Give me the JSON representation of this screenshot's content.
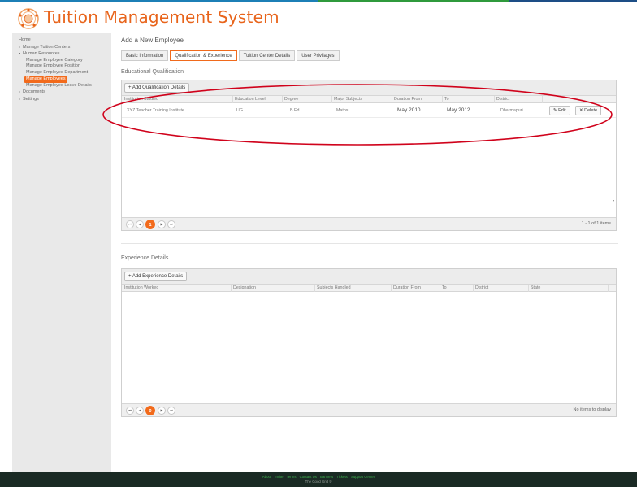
{
  "app": {
    "title": "Tuition Management System"
  },
  "sidebar": {
    "items": [
      {
        "label": "Home",
        "level": 0,
        "caret": ""
      },
      {
        "label": "Manage Tuition Centers",
        "level": 0,
        "caret": "▸"
      },
      {
        "label": "Human Resources",
        "level": 0,
        "caret": "▾"
      },
      {
        "label": "Manage Employee Category",
        "level": 1,
        "caret": ""
      },
      {
        "label": "Manage Employee Position",
        "level": 1,
        "caret": ""
      },
      {
        "label": "Manage Employee Department",
        "level": 1,
        "caret": ""
      },
      {
        "label": "Manage Employees",
        "level": 1,
        "caret": "",
        "active": true
      },
      {
        "label": "Manage Employee Leave Details",
        "level": 1,
        "caret": ""
      },
      {
        "label": "Documents",
        "level": 0,
        "caret": "▸"
      },
      {
        "label": "Settings",
        "level": 0,
        "caret": "▸"
      }
    ]
  },
  "page": {
    "title": "Add a New Employee"
  },
  "tabs": [
    {
      "label": "Basic Information"
    },
    {
      "label": "Qualification & Experience",
      "active": true
    },
    {
      "label": "Tuition Center Details"
    },
    {
      "label": "User Privilages"
    }
  ],
  "qualification": {
    "title": "Educational Qualification",
    "add_label": "+ Add Qualification Details",
    "columns": [
      "Institution Studied",
      "Education Level",
      "Degree",
      "Major Subjects",
      "Duration From",
      "To",
      "District"
    ],
    "rows": [
      {
        "institution": "XYZ Teacher Training Institute",
        "level": "UG",
        "degree": "B.Ed",
        "subjects": "Maths",
        "from": "May 2010",
        "to": "May 2012",
        "district": "Dharmapuri"
      }
    ],
    "edit_label": "✎ Edit",
    "delete_label": "✕ Delete",
    "pager": {
      "current": "1",
      "info": "1 - 1 of 1 items"
    }
  },
  "experience": {
    "title": "Experience Details",
    "add_label": "+ Add Experience Details",
    "columns": [
      "Institution Worked",
      "Designation",
      "Subjects Handled",
      "Duration From",
      "To",
      "District",
      "State"
    ],
    "pager": {
      "current": "0",
      "info": "No items to display"
    }
  },
  "footer": {
    "links": [
      "About",
      "Invite",
      "Terms",
      "Contact Us",
      "Banners",
      "Tickets",
      "Support Center"
    ],
    "copyright": "The Good Grid ©"
  },
  "colors": {
    "accent": "#f26a1b",
    "annotation": "#d0021b",
    "footer_bg": "#1a2a24",
    "footer_link": "#3fb34f"
  }
}
